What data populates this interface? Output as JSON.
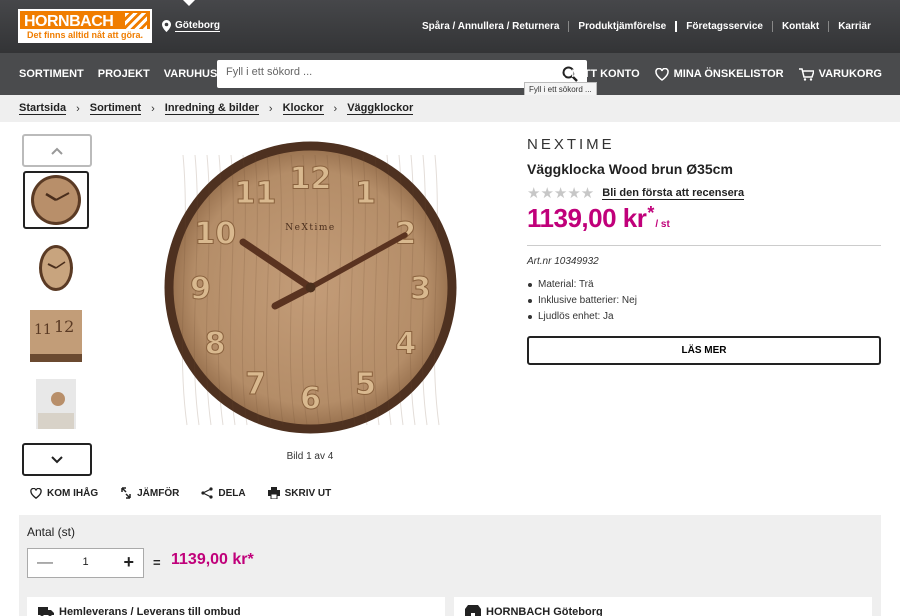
{
  "header": {
    "logo_brand": "HORNBACH",
    "logo_slogan": "Det finns alltid nåt att göra.",
    "store": "Göteborg",
    "top_links": [
      "Spåra / Annullera / Returnera",
      "Produktjämförelse",
      "Företagsservice",
      "Kontakt",
      "Karriär"
    ]
  },
  "nav": {
    "items": [
      "SORTIMENT",
      "PROJEKT",
      "VARUHUSINFO"
    ],
    "search_placeholder": "Fyll i ett sökord ...",
    "tooltip": "Fyll i ett sökord ...",
    "account": "MITT KONTO",
    "wishlist": "MINA ÖNSKELISTOR",
    "cart": "VARUKORG"
  },
  "breadcrumb": [
    "Startsida",
    "Sortiment",
    "Inredning & bilder",
    "Klockor",
    "Väggklockor"
  ],
  "gallery": {
    "counter": "Bild 1 av 4",
    "clock_brand": "NeXtime",
    "numerals": [
      "12",
      "1",
      "2",
      "3",
      "4",
      "5",
      "6",
      "7",
      "8",
      "9",
      "10",
      "11"
    ]
  },
  "product": {
    "brand": "NEXTIME",
    "title": "Väggklocka Wood brun Ø35cm",
    "stars_filled": 0,
    "review_link": "Bli den första att recensera",
    "price": "1139,00 kr",
    "price_star": "*",
    "price_unit": "/ st",
    "article": "Art.nr 10349932",
    "features": [
      "Material: Trä",
      "Inklusive batterier: Nej",
      "Ljudlös enhet: Ja"
    ],
    "read_more": "LÄS MER"
  },
  "actions": [
    "KOM IHÅG",
    "JÄMFÖR",
    "DELA",
    "SKRIV UT"
  ],
  "quantity": {
    "label": "Antal (st)",
    "value": "1",
    "equals": "=",
    "total": "1139,00 kr*"
  },
  "delivery": {
    "home": "Hemleverans / Leverans till ombud",
    "store": "HORNBACH Göteborg"
  },
  "colors": {
    "accent": "#c0007a",
    "brand": "#f07d00",
    "header": "#3a3b3d"
  }
}
